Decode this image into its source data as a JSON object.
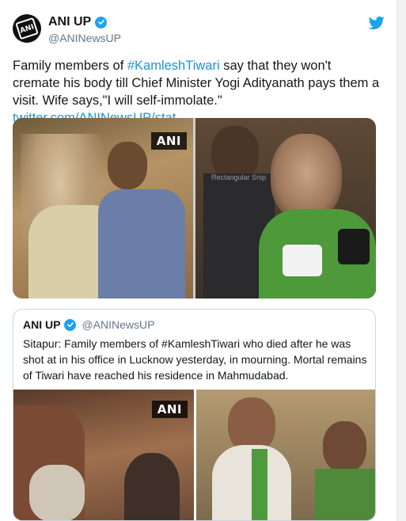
{
  "tweet": {
    "display_name": "ANI UP",
    "handle": "@ANINewsUP",
    "avatar_text": "ANI",
    "text_parts": {
      "before": "Family members of ",
      "hashtag": "#KamleshTiwari",
      "middle": " say that they won't cremate his body till Chief Minister Yogi Adityanath pays them a visit. Wife says,\"I will self-immolate.\" ",
      "link": "twitter.com/ANINewsUP/stat…"
    },
    "media": {
      "left_watermark": "ANI",
      "right_overlay_label": "Rectangular Snip"
    }
  },
  "quoted_tweet": {
    "display_name": "ANI UP",
    "handle": "@ANINewsUP",
    "text": "Sitapur: Family members of #KamleshTiwari who died after he was shot at in his office in Lucknow yesterday, in mourning. Mortal remains of Tiwari have reached his residence in Mahmudabad.",
    "media": {
      "left_watermark": "ANI"
    }
  },
  "icons": {
    "verified": "verified-badge-icon",
    "platform": "twitter-bird-icon"
  },
  "colors": {
    "link": "#1b95e0",
    "verified": "#1da1f2",
    "secondary_text": "#657786",
    "border": "#ccd6dd"
  }
}
